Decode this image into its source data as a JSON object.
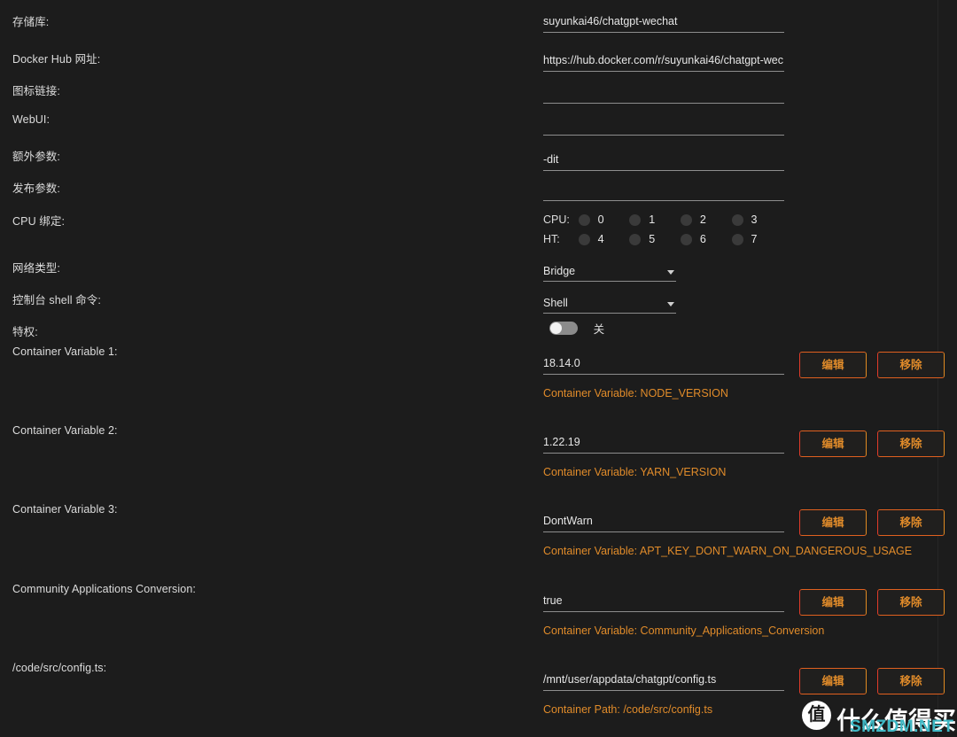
{
  "theme": {
    "background": "#1c1c1c",
    "text": "#dcdcdc",
    "accent_orange": "#e08b2a",
    "button_border_left": "#e03b2a",
    "button_border_right": "#e08a22",
    "field_underline": "#8d8d8d"
  },
  "form": {
    "rows": [
      {
        "label": "存储库:",
        "value": "suyunkai46/chatgpt-wechat"
      },
      {
        "label": "Docker Hub 网址:",
        "value": "https://hub.docker.com/r/suyunkai46/chatgpt-wec"
      },
      {
        "label": "图标链接:",
        "value": ""
      },
      {
        "label": "WebUI:",
        "value": ""
      },
      {
        "label": "额外参数:",
        "value": "-dit"
      },
      {
        "label": "发布参数:",
        "value": ""
      }
    ],
    "cpu_pinning": {
      "label": "CPU 绑定:",
      "rows": [
        {
          "tag": "CPU:",
          "cores": [
            "0",
            "1",
            "2",
            "3"
          ]
        },
        {
          "tag": "HT:",
          "cores": [
            "4",
            "5",
            "6",
            "7"
          ]
        }
      ]
    },
    "network_type": {
      "label": "网络类型:",
      "value": "Bridge"
    },
    "console_shell": {
      "label": "控制台 shell 命令:",
      "value": "Shell"
    },
    "privileged": {
      "label": "特权:",
      "state": "关"
    }
  },
  "buttons": {
    "edit_label": "编辑",
    "remove_label": "移除"
  },
  "variables": [
    {
      "label": "Container Variable 1:",
      "value": "18.14.0",
      "caption": "Container Variable: NODE_VERSION"
    },
    {
      "label": "Container Variable 2:",
      "value": "1.22.19",
      "caption": "Container Variable: YARN_VERSION"
    },
    {
      "label": "Container Variable 3:",
      "value": "DontWarn",
      "caption": "Container Variable: APT_KEY_DONT_WARN_ON_DANGEROUS_USAGE"
    },
    {
      "label": "Community Applications Conversion:",
      "value": "true",
      "caption": "Container Variable: Community_Applications_Conversion"
    },
    {
      "label": "/code/src/config.ts:",
      "value": "/mnt/user/appdata/chatgpt/config.ts",
      "caption": "Container Path: /code/src/config.ts"
    }
  ],
  "watermark": {
    "badge": "值",
    "title": "什么值得买",
    "site": "SMZDM.NET"
  }
}
